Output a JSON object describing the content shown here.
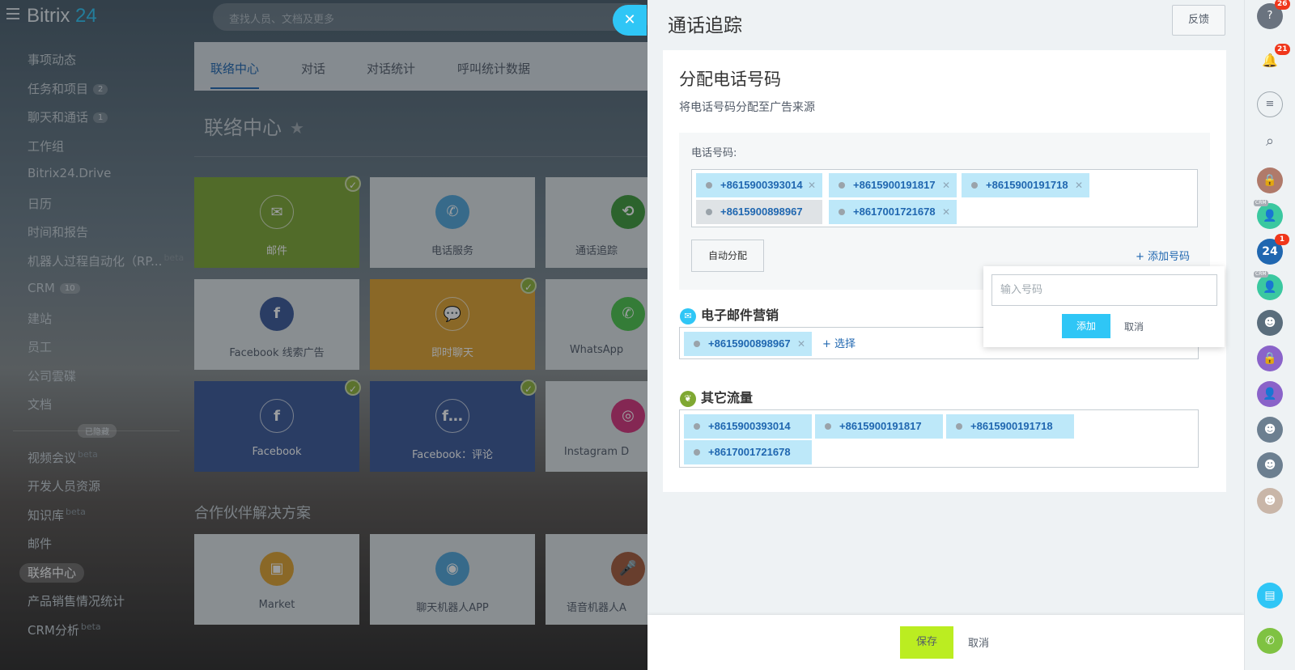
{
  "app": {
    "logo_main": "Bitrix",
    "logo_num": " 24",
    "search_placeholder": "查找人员、文档及更多"
  },
  "nav": {
    "items": [
      {
        "label": "事项动态",
        "count": "",
        "beta": ""
      },
      {
        "label": "任务和项目",
        "count": "2",
        "beta": ""
      },
      {
        "label": "聊天和通话",
        "count": "1",
        "beta": ""
      },
      {
        "label": "工作组",
        "count": "",
        "beta": ""
      },
      {
        "label": "Bitrix24.Drive",
        "count": "",
        "beta": ""
      },
      {
        "label": "日历",
        "count": "",
        "beta": ""
      },
      {
        "label": "时间和报告",
        "count": "",
        "beta": ""
      },
      {
        "label": "机器人过程自动化（RP...",
        "count": "",
        "beta": "beta"
      },
      {
        "label": "CRM",
        "count": "10",
        "beta": ""
      },
      {
        "label": "建站",
        "count": "",
        "beta": ""
      },
      {
        "label": "员工",
        "count": "",
        "beta": ""
      },
      {
        "label": "公司雲碟",
        "count": "",
        "beta": ""
      },
      {
        "label": "文档",
        "count": "",
        "beta": ""
      }
    ],
    "hidden_label": "已隐藏",
    "hidden_items": [
      {
        "label": "视频会议",
        "beta": "beta"
      },
      {
        "label": "开发人员资源",
        "beta": ""
      },
      {
        "label": "知识库",
        "beta": "beta"
      },
      {
        "label": "邮件",
        "beta": ""
      },
      {
        "label": "联络中心",
        "beta": ""
      },
      {
        "label": "产品销售情况统计",
        "beta": ""
      },
      {
        "label": "CRM分析",
        "beta": "beta"
      }
    ]
  },
  "tabs": [
    "联络中心",
    "对话",
    "对话统计",
    "呼叫统计数据"
  ],
  "contact_center": {
    "title": "联络中心",
    "tiles": [
      {
        "label": "邮件",
        "icon": "mail-icon",
        "glyph": "✉",
        "color": "#7fa832",
        "ico_bg": "",
        "checked": true
      },
      {
        "label": "电话服务",
        "icon": "phone-icon",
        "glyph": "✆",
        "color": "#dfe3e6",
        "ico_bg": "#52a6d9",
        "checked": false
      },
      {
        "label": "通话追踪",
        "icon": "call-tracking-icon",
        "glyph": "⟲",
        "color": "#dfe3e6",
        "ico_bg": "#3e9a3a",
        "checked": false
      },
      {
        "label": "Facebook 线索广告",
        "icon": "facebook-leads-icon",
        "glyph": "f",
        "color": "#dfe3e6",
        "ico_bg": "#3b5998",
        "checked": false
      },
      {
        "label": "即时聊天",
        "icon": "live-chat-icon",
        "glyph": "💬",
        "color": "#e0a32f",
        "ico_bg": "",
        "checked": true
      },
      {
        "label": "WhatsApp",
        "icon": "whatsapp-icon",
        "glyph": "✆",
        "color": "#dfe3e6",
        "ico_bg": "#4cc54a",
        "checked": false
      },
      {
        "label": "Facebook",
        "icon": "facebook-icon",
        "glyph": "f",
        "color": "#3b5998",
        "ico_bg": "",
        "checked": true
      },
      {
        "label": "Facebook：评论",
        "icon": "facebook-comments-icon",
        "glyph": "f…",
        "color": "#3b5998",
        "ico_bg": "",
        "checked": true
      },
      {
        "label": "Instagram D",
        "icon": "instagram-icon",
        "glyph": "◎",
        "color": "#dfe3e6",
        "ico_bg": "#d6337a",
        "checked": false
      }
    ],
    "partner_title": "合作伙伴解决方案",
    "partner_tiles": [
      {
        "label": "Market",
        "icon": "market-icon",
        "glyph": "▣",
        "ico_bg": "#e0a32f"
      },
      {
        "label": "聊天机器人APP",
        "icon": "chatbot-icon",
        "glyph": "◉",
        "ico_bg": "#52a6d9"
      },
      {
        "label": "语音机器人A",
        "icon": "voice-bot-icon",
        "glyph": "🎤",
        "ico_bg": "#a65a3a"
      }
    ]
  },
  "panel": {
    "title": "通话追踪",
    "feedback": "反馈",
    "section_title": "分配电话号码",
    "section_sub": "将电话号码分配至广告来源",
    "phone_label": "电话号码:",
    "phones": [
      {
        "number": "+8615900393014",
        "grey": false
      },
      {
        "number": "+8615900191817",
        "grey": false
      },
      {
        "number": "+8615900191718",
        "grey": false
      },
      {
        "number": "+8615900898967",
        "grey": true
      },
      {
        "number": "+8617001721678",
        "grey": false
      }
    ],
    "auto_assign": "自动分配",
    "add_number": "+ 添加号码",
    "email_marketing": {
      "title": "电子邮件营销",
      "number": "+8615900898967",
      "select": "+ 选择"
    },
    "other_traffic": {
      "title": "其它流量",
      "numbers": [
        "+8615900393014",
        "+8615900191817",
        "+8615900191718",
        "+8617001721678"
      ]
    },
    "popup": {
      "placeholder": "输入号码",
      "add": "添加",
      "cancel": "取消"
    },
    "save": "保存",
    "cancel": "取消"
  },
  "right_bar": {
    "help_badge": "26",
    "notif_badge": "21",
    "b24_badge": "1",
    "b24_label": "24",
    "crm_tag": "CRM"
  },
  "colors": {
    "accent": "#2fc6f6",
    "link": "#2067b0",
    "save": "#bbed21",
    "chip": "#bde8f9"
  }
}
